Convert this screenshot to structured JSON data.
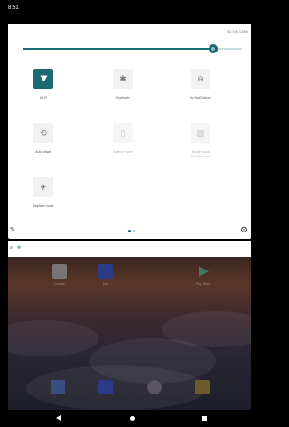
{
  "status_bar": {
    "time": "8:51"
  },
  "quick_settings": {
    "sim_status": "NO SIM CARD",
    "brightness_level": 0.87,
    "accent_color": "#1a6a73",
    "tiles": [
      {
        "label": "Wi-Fi",
        "icon": "wifi-icon",
        "state": "on"
      },
      {
        "label": "Bluetooth",
        "icon": "bluetooth-icon",
        "state": "off"
      },
      {
        "label": "Do Not Disturb",
        "icon": "do-not-disturb-icon",
        "state": "off"
      },
      {
        "label": "Auto-rotate",
        "icon": "auto-rotate-icon",
        "state": "off"
      },
      {
        "label": "Battery Saver",
        "icon": "battery-saver-icon",
        "state": "disabled"
      },
      {
        "label": "Mobile data",
        "label2": "No SIM card",
        "icon": "mobile-data-icon",
        "state": "disabled"
      },
      {
        "label": "Airplane mode",
        "icon": "airplane-icon",
        "state": "off"
      }
    ],
    "footer": {
      "edit_icon": "edit-icon",
      "settings_icon": "gear-icon",
      "page": 1,
      "pages": 2
    }
  },
  "notifications": {
    "icons": [
      "notification-icon",
      "settings-notification-icon"
    ]
  },
  "home_screen": {
    "apps": [
      {
        "label": "Google",
        "icon": "google-folder-icon"
      },
      {
        "label": "Duo",
        "icon": "duo-icon"
      },
      {
        "label": "Play Store",
        "icon": "play-store-icon"
      }
    ],
    "dock": [
      {
        "icon": "phone-icon"
      },
      {
        "icon": "messages-icon"
      },
      {
        "icon": "chrome-icon"
      },
      {
        "icon": "camera-icon"
      }
    ]
  }
}
